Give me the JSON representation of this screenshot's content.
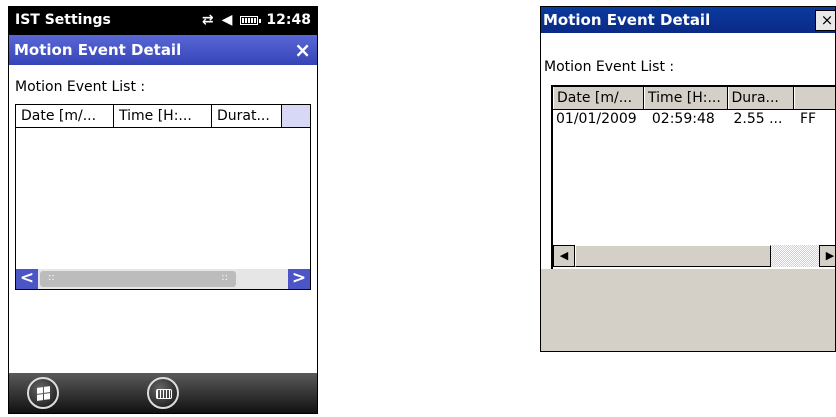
{
  "left_device": {
    "status_bar": {
      "title": "IST Settings",
      "connectivity_icon": "⇄",
      "speaker_icon": "◀",
      "time": "12:48"
    },
    "window": {
      "title": "Motion Event Detail",
      "close_label": "×"
    },
    "list_label": "Motion Event List :",
    "columns": [
      "Date [m/...",
      "Time [H:...",
      "Durat..."
    ],
    "scrollbar": {
      "left_arrow": "<",
      "right_arrow": ">",
      "grip_left": "::",
      "grip_right": "::"
    },
    "taskbar": {
      "keyboard_label": "keyboard"
    }
  },
  "right_device": {
    "window": {
      "title": "Motion Event Detail",
      "close_label": "×"
    },
    "list_label": "Motion Event List :",
    "columns": [
      "Date [m/...",
      "Time [H:...",
      "Dura...",
      ""
    ],
    "rows": [
      {
        "date": "01/01/2009",
        "time": "02:59:48",
        "duration": "2.55 ...",
        "extra": "FF"
      }
    ],
    "scrollbar": {
      "left_arrow": "◀",
      "right_arrow": "▶"
    }
  }
}
